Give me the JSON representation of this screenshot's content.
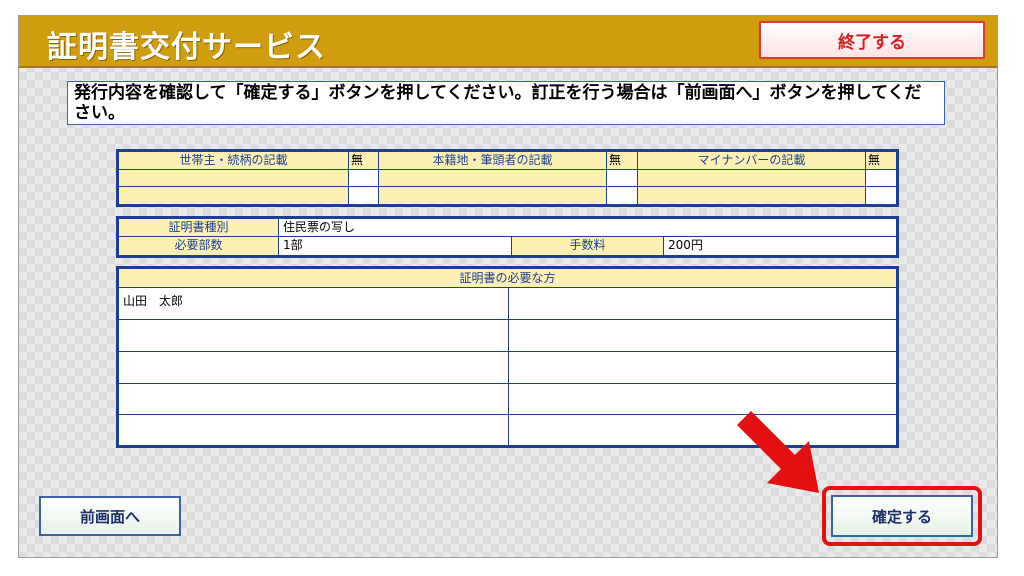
{
  "header": {
    "title": "証明書交付サービス",
    "end_button": "終了する"
  },
  "instruction": "発行内容を確認して「確定する」ボタンを押してください。訂正を行う場合は「前画面へ」ボタンを押してください。",
  "records_table": {
    "columns": [
      {
        "label": "世帯主・続柄の記載",
        "value": "無"
      },
      {
        "label": "本籍地・筆頭者の記載",
        "value": "無"
      },
      {
        "label": "マイナンバーの記載",
        "value": "無"
      }
    ]
  },
  "cert_info": {
    "type_label": "証明書種別",
    "type_value": "住民票の写し",
    "copies_label": "必要部数",
    "copies_value": "1部",
    "fee_label": "手数料",
    "fee_value": "200円"
  },
  "persons": {
    "header": "証明書の必要な方",
    "names": [
      "山田　太郎",
      "",
      "",
      "",
      "",
      "",
      "",
      "",
      "",
      ""
    ]
  },
  "buttons": {
    "prev": "前画面へ",
    "confirm": "確定する"
  },
  "colors": {
    "header_bg": "#d09d0e",
    "table_border": "#1c3f93",
    "table_header_bg": "#fdf0b3",
    "highlight": "#e21010"
  },
  "icons": {
    "pointer_arrow": "red-arrow-icon"
  }
}
